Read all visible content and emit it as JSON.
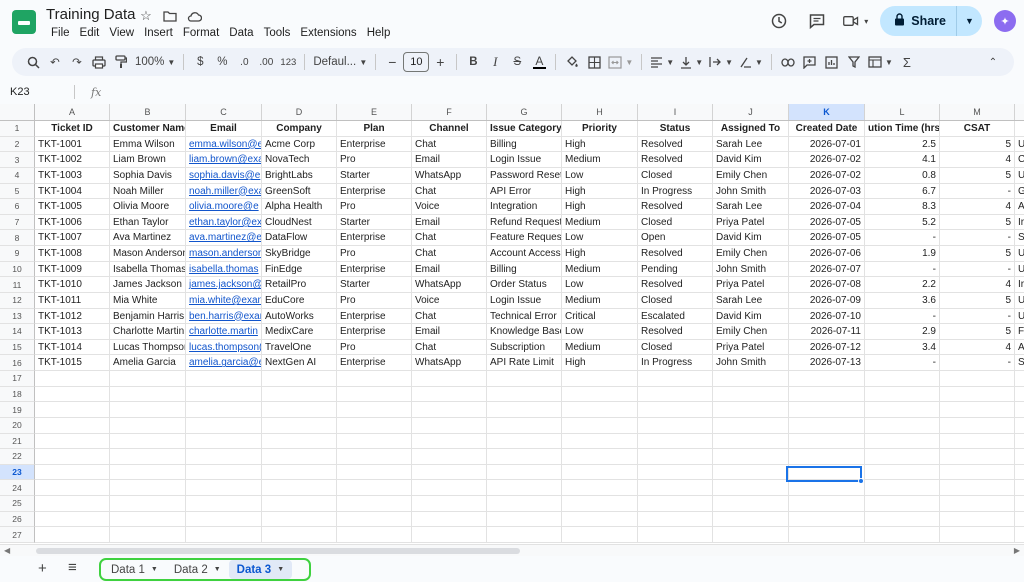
{
  "title_bar": {
    "doc_title": "Training Data",
    "menu": [
      "File",
      "Edit",
      "View",
      "Insert",
      "Format",
      "Data",
      "Tools",
      "Extensions",
      "Help"
    ],
    "share_label": "Share"
  },
  "toolbar": {
    "zoom": "100%",
    "currency": "$",
    "percent": "%",
    "dec_decrease": ".0",
    "dec_increase": ".00",
    "number_format": "123",
    "font": "Defaul...",
    "font_size": "10",
    "minus": "−",
    "plus": "+"
  },
  "formula_bar": {
    "name_box": "K23",
    "fx": "fx",
    "value": ""
  },
  "grid": {
    "columns": [
      "A",
      "B",
      "C",
      "D",
      "E",
      "F",
      "G",
      "H",
      "I",
      "J",
      "K",
      "L",
      "M"
    ],
    "selected_column": "K",
    "selected_row": "23",
    "headers": [
      "Ticket ID",
      "Customer Name",
      "Email",
      "Company",
      "Plan",
      "Channel",
      "Issue Category",
      "Priority",
      "Status",
      "Assigned To",
      "Created Date",
      "ution Time (hrs)",
      "CSAT"
    ],
    "rows": [
      [
        "TKT-1001",
        "Emma Wilson",
        "emma.wilson@e",
        "Acme Corp",
        "Enterprise",
        "Chat",
        "Billing",
        "High",
        "Resolved",
        "Sarah Lee",
        "2026-07-01",
        "2.5",
        "5",
        "U"
      ],
      [
        "TKT-1002",
        "Liam Brown",
        "liam.brown@exa",
        "NovaTech",
        "Pro",
        "Email",
        "Login Issue",
        "Medium",
        "Resolved",
        "David Kim",
        "2026-07-02",
        "4.1",
        "4",
        "C"
      ],
      [
        "TKT-1003",
        "Sophia Davis",
        "sophia.davis@e",
        "BrightLabs",
        "Starter",
        "WhatsApp",
        "Password Reset",
        "Low",
        "Closed",
        "Emily Chen",
        "2026-07-02",
        "0.8",
        "5",
        "U"
      ],
      [
        "TKT-1004",
        "Noah Miller",
        "noah.miller@exa",
        "GreenSoft",
        "Enterprise",
        "Chat",
        "API Error",
        "High",
        "In Progress",
        "John Smith",
        "2026-07-03",
        "6.7",
        "-",
        "G"
      ],
      [
        "TKT-1005",
        "Olivia Moore",
        "olivia.moore@e",
        "Alpha Health",
        "Pro",
        "Voice",
        "Integration",
        "High",
        "Resolved",
        "Sarah Lee",
        "2026-07-04",
        "8.3",
        "4",
        "A"
      ],
      [
        "TKT-1006",
        "Ethan Taylor",
        "ethan.taylor@ex",
        "CloudNest",
        "Starter",
        "Email",
        "Refund Request",
        "Medium",
        "Closed",
        "Priya Patel",
        "2026-07-05",
        "5.2",
        "5",
        "Ir"
      ],
      [
        "TKT-1007",
        "Ava Martinez",
        "ava.martinez@e",
        "DataFlow",
        "Enterprise",
        "Chat",
        "Feature Request",
        "Low",
        "Open",
        "David Kim",
        "2026-07-05",
        "-",
        "-",
        "S"
      ],
      [
        "TKT-1008",
        "Mason Anderson",
        "mason.anderson",
        "SkyBridge",
        "Pro",
        "Chat",
        "Account Access",
        "High",
        "Resolved",
        "Emily Chen",
        "2026-07-06",
        "1.9",
        "5",
        "U"
      ],
      [
        "TKT-1009",
        "Isabella Thomas",
        "isabella.thomas",
        "FinEdge",
        "Enterprise",
        "Email",
        "Billing",
        "Medium",
        "Pending",
        "John Smith",
        "2026-07-07",
        "-",
        "-",
        "U"
      ],
      [
        "TKT-1010",
        "James Jackson",
        "james.jackson@",
        "RetailPro",
        "Starter",
        "WhatsApp",
        "Order Status",
        "Low",
        "Resolved",
        "Priya Patel",
        "2026-07-08",
        "2.2",
        "4",
        "Ir"
      ],
      [
        "TKT-1011",
        "Mia White",
        "mia.white@exan",
        "EduCore",
        "Pro",
        "Voice",
        "Login Issue",
        "Medium",
        "Closed",
        "Sarah Lee",
        "2026-07-09",
        "3.6",
        "5",
        "U"
      ],
      [
        "TKT-1012",
        "Benjamin Harris",
        "ben.harris@exar",
        "AutoWorks",
        "Enterprise",
        "Chat",
        "Technical Error",
        "Critical",
        "Escalated",
        "David Kim",
        "2026-07-10",
        "-",
        "-",
        "U"
      ],
      [
        "TKT-1013",
        "Charlotte Martin",
        "charlotte.martin",
        "MedixCare",
        "Enterprise",
        "Email",
        "Knowledge Base",
        "Low",
        "Resolved",
        "Emily Chen",
        "2026-07-11",
        "2.9",
        "5",
        "F"
      ],
      [
        "TKT-1014",
        "Lucas Thompson",
        "lucas.thompson(",
        "TravelOne",
        "Pro",
        "Chat",
        "Subscription",
        "Medium",
        "Closed",
        "Priya Patel",
        "2026-07-12",
        "3.4",
        "4",
        "A"
      ],
      [
        "TKT-1015",
        "Amelia Garcia",
        "amelia.garcia@e",
        "NextGen AI",
        "Enterprise",
        "WhatsApp",
        "API Rate Limit",
        "High",
        "In Progress",
        "John Smith",
        "2026-07-13",
        "-",
        "-",
        "S"
      ]
    ],
    "row_numbers": [
      "1",
      "2",
      "3",
      "4",
      "5",
      "6",
      "7",
      "8",
      "9",
      "10",
      "11",
      "12",
      "13",
      "14",
      "15",
      "16",
      "17",
      "18",
      "19",
      "20",
      "21",
      "22",
      "23",
      "24",
      "25",
      "26",
      "27"
    ]
  },
  "sheet_tabs": [
    {
      "label": "Data 1",
      "active": false
    },
    {
      "label": "Data 2",
      "active": false
    },
    {
      "label": "Data 3",
      "active": true
    }
  ],
  "colors": {
    "accent": "#1a73e8",
    "share_bg": "#c2e7ff",
    "link": "#1155cc",
    "tab_highlight": "#3fd13f",
    "logo": "#1fa463"
  }
}
